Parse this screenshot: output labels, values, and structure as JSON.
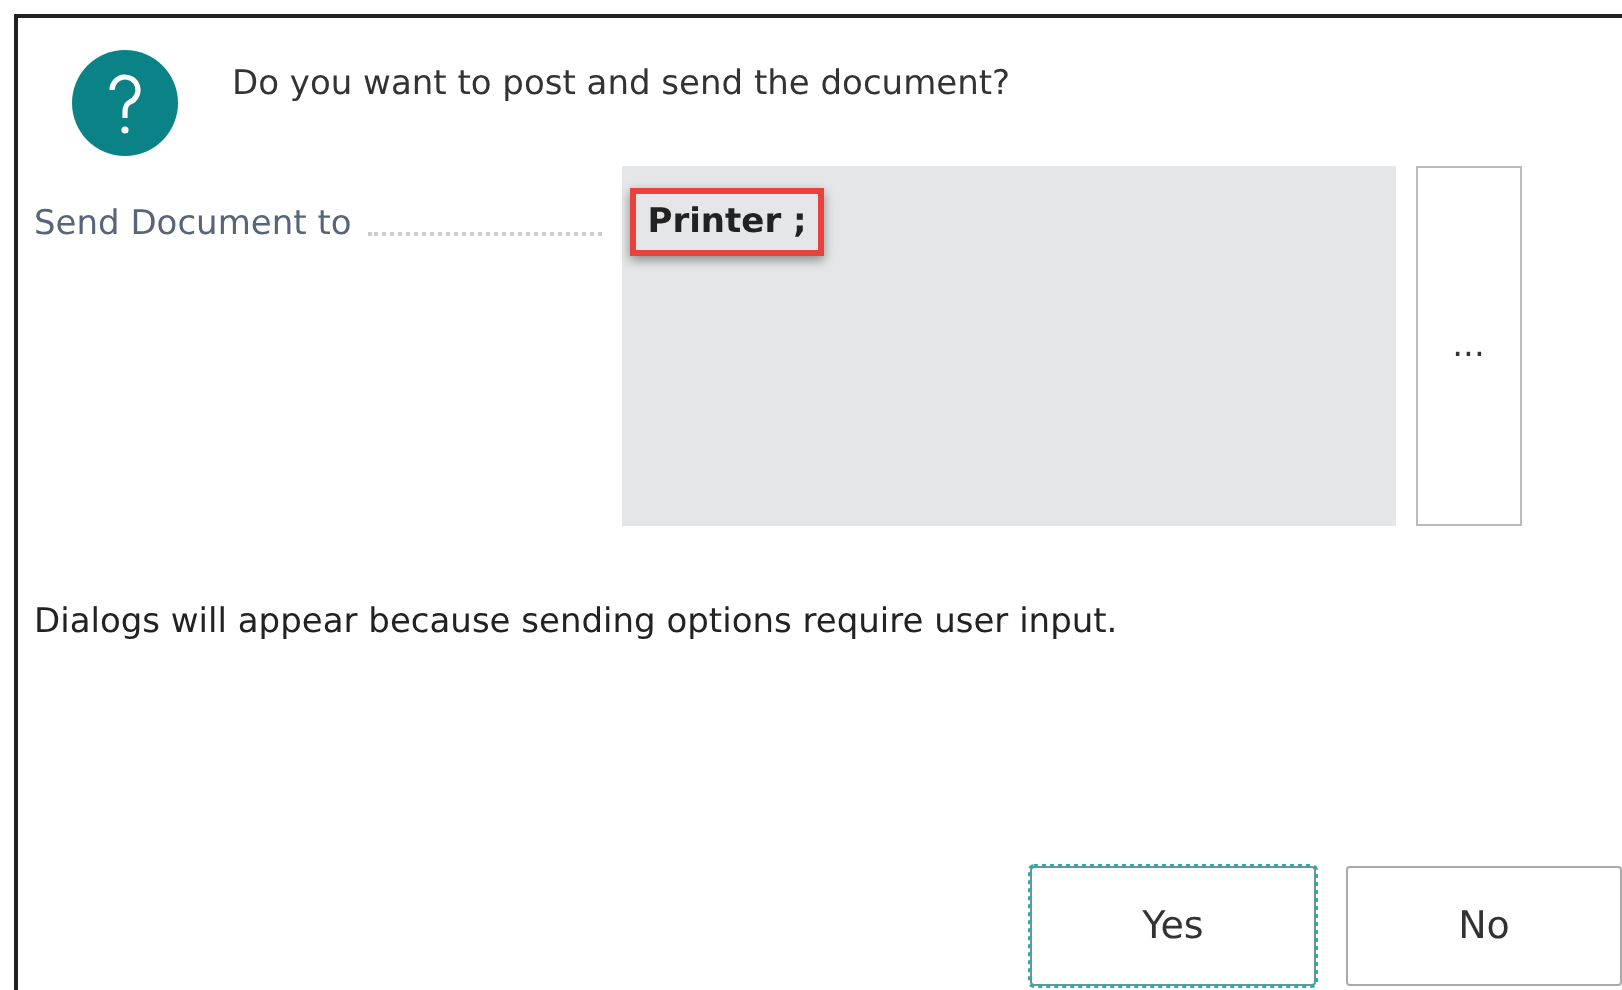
{
  "dialog": {
    "question": "Do you want to post and send the document?",
    "field": {
      "label": "Send Document to",
      "value": "Printer ;",
      "highlighted": true,
      "lookup_button": "..."
    },
    "message": "Dialogs will appear because sending options require user input.",
    "buttons": [
      {
        "label": "Yes",
        "focused": true
      },
      {
        "label": "No",
        "focused": false
      }
    ]
  }
}
